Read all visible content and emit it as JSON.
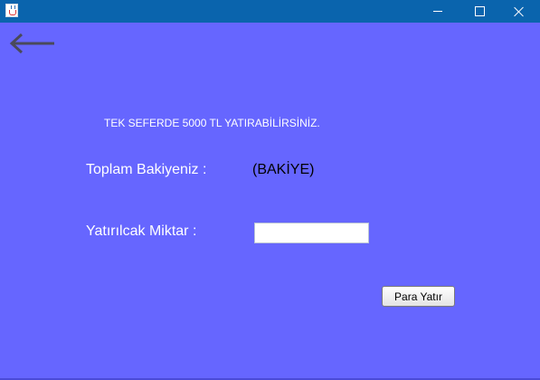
{
  "window": {
    "icon": "java-cup-icon",
    "controls": [
      "minimize-icon",
      "maximize-icon",
      "close-icon"
    ],
    "titlebar_color": "#0a64ad"
  },
  "colors": {
    "background": "#6666ff",
    "label_text": "#ffffff",
    "value_text": "#000000"
  },
  "nav": {
    "back_icon": "back-arrow-icon"
  },
  "notice": "TEK SEFERDE 5000 TL YATIRABİLİRSİNİZ.",
  "balance": {
    "label": "Toplam Bakiyeniz :",
    "value": "(BAKİYE)"
  },
  "deposit": {
    "label": "Yatırılcak Miktar :",
    "input_value": "",
    "button_label": "Para Yatır"
  }
}
